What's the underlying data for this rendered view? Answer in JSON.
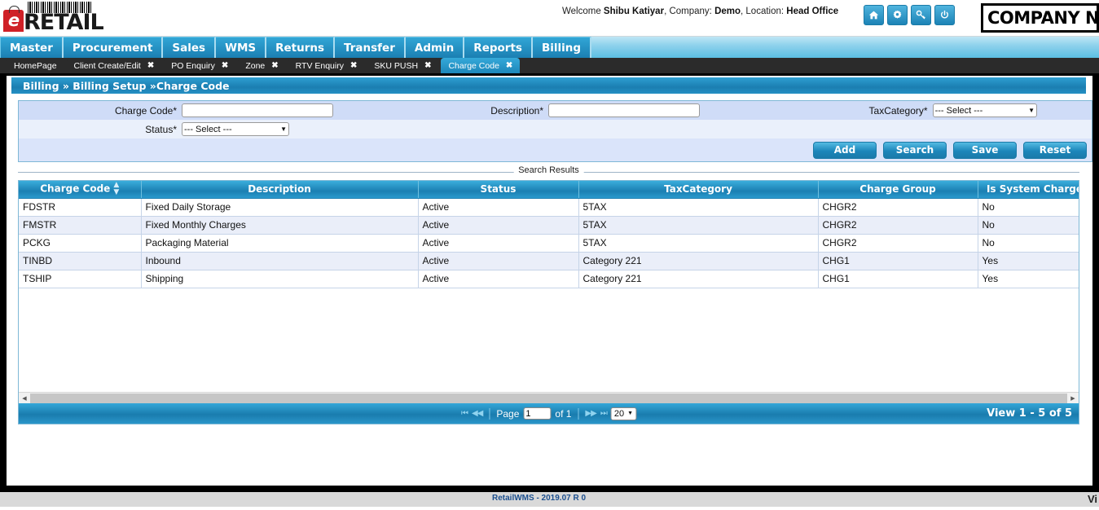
{
  "header": {
    "logo_text": "RETAIL",
    "logo_badge": "e",
    "welcome_prefix": "Welcome ",
    "user_name": "Shibu Katiyar",
    "company_label": ", Company: ",
    "company_value": "Demo",
    "location_label": ", Location: ",
    "location_value": "Head Office",
    "company_box_text": "COMPANY NAM",
    "icons": [
      {
        "name": "home-icon",
        "glyph": "⌂"
      },
      {
        "name": "gear-icon",
        "glyph": "⚙"
      },
      {
        "name": "key-icon",
        "glyph": "⚷"
      },
      {
        "name": "power-icon",
        "glyph": "⏻"
      }
    ]
  },
  "mainmenu": [
    {
      "label": "Master"
    },
    {
      "label": "Procurement"
    },
    {
      "label": "Sales"
    },
    {
      "label": "WMS"
    },
    {
      "label": "Returns"
    },
    {
      "label": "Transfer"
    },
    {
      "label": "Admin"
    },
    {
      "label": "Reports"
    },
    {
      "label": "Billing"
    }
  ],
  "tabs": [
    {
      "label": "HomePage",
      "closable": false,
      "active": false
    },
    {
      "label": "Client Create/Edit",
      "closable": true,
      "active": false
    },
    {
      "label": "PO Enquiry",
      "closable": true,
      "active": false
    },
    {
      "label": "Zone",
      "closable": true,
      "active": false
    },
    {
      "label": "RTV Enquiry",
      "closable": true,
      "active": false
    },
    {
      "label": "SKU PUSH",
      "closable": true,
      "active": false
    },
    {
      "label": "Charge Code",
      "closable": true,
      "active": true
    }
  ],
  "breadcrumb": "Billing » Billing Setup »Charge Code",
  "form": {
    "charge_code_label": "Charge Code*",
    "charge_code_value": "",
    "description_label": "Description*",
    "description_value": "",
    "taxcategory_label": "TaxCategory*",
    "taxcategory_value": "--- Select ---",
    "status_label": "Status*",
    "status_value": "--- Select ---",
    "buttons": [
      {
        "label": "Add"
      },
      {
        "label": "Search"
      },
      {
        "label": "Save"
      },
      {
        "label": "Reset"
      }
    ]
  },
  "results": {
    "legend": "Search Results",
    "columns": [
      "Charge Code",
      "Description",
      "Status",
      "TaxCategory",
      "Charge Group",
      "Is System Charge"
    ],
    "sorted_column": "Charge Code",
    "rows": [
      {
        "charge_code": "FDSTR",
        "description": "Fixed Daily Storage",
        "status": "Active",
        "taxcategory": "5TAX",
        "charge_group": "CHGR2",
        "is_system_charge": "No"
      },
      {
        "charge_code": "FMSTR",
        "description": "Fixed Monthly Charges",
        "status": "Active",
        "taxcategory": "5TAX",
        "charge_group": "CHGR2",
        "is_system_charge": "No"
      },
      {
        "charge_code": "PCKG",
        "description": "Packaging Material",
        "status": "Active",
        "taxcategory": "5TAX",
        "charge_group": "CHGR2",
        "is_system_charge": "No"
      },
      {
        "charge_code": "TINBD",
        "description": "Inbound",
        "status": "Active",
        "taxcategory": "Category 221",
        "charge_group": "CHG1",
        "is_system_charge": "Yes"
      },
      {
        "charge_code": "TSHIP",
        "description": "Shipping",
        "status": "Active",
        "taxcategory": "Category 221",
        "charge_group": "CHG1",
        "is_system_charge": "Yes"
      }
    ]
  },
  "pager": {
    "first_label": "⏮",
    "prev_label": "◀◀",
    "next_label": "▶▶",
    "last_label": "⏭",
    "page_label": "Page",
    "page_value": "1",
    "of_label": "of 1",
    "page_size": "20",
    "view_summary": "View 1 - 5 of 5"
  },
  "footer": {
    "version_text": "RetailWMS - 2019.07 R 0",
    "right_text": "Vi"
  },
  "colors": {
    "accent": "#1b7fb2",
    "accent_light": "#35a9d9",
    "header_gradient_top": "#3aaedc",
    "row_even": "#eaeef9",
    "panel_bg": "#e8eefb"
  }
}
